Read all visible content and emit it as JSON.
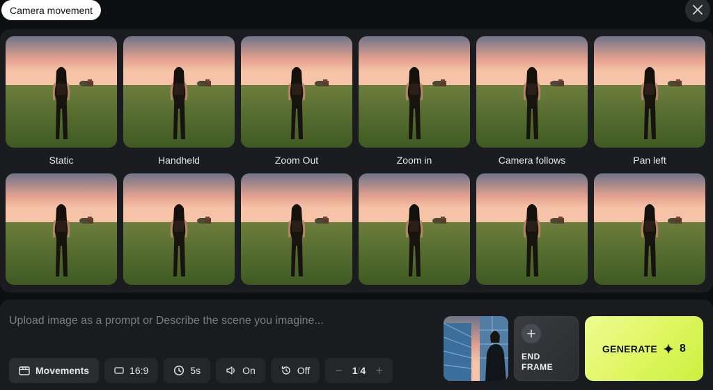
{
  "header": {
    "title": "Camera movement",
    "close_icon": "close-icon"
  },
  "movements": [
    {
      "label": "Static"
    },
    {
      "label": "Handheld"
    },
    {
      "label": "Zoom Out"
    },
    {
      "label": "Zoom in"
    },
    {
      "label": "Camera follows"
    },
    {
      "label": "Pan left"
    },
    {
      "label": ""
    },
    {
      "label": ""
    },
    {
      "label": ""
    },
    {
      "label": ""
    },
    {
      "label": ""
    },
    {
      "label": ""
    }
  ],
  "composer": {
    "placeholder": "Upload image as a prompt or Describe the scene you imagine...",
    "toolbar": {
      "movements_label": "Movements",
      "aspect_label": "16:9",
      "duration_label": "5s",
      "sound_label": "On",
      "loop_label": "Off",
      "count_current": "1",
      "count_sep": "/",
      "count_total": "4"
    },
    "end_frame_line1": "END",
    "end_frame_line2": "FRAME",
    "generate_label": "GENERATE",
    "generate_credits": "8"
  },
  "colors": {
    "accent": "#dcf55a",
    "panel": "#1b1c1f",
    "background": "#0e0f11"
  }
}
